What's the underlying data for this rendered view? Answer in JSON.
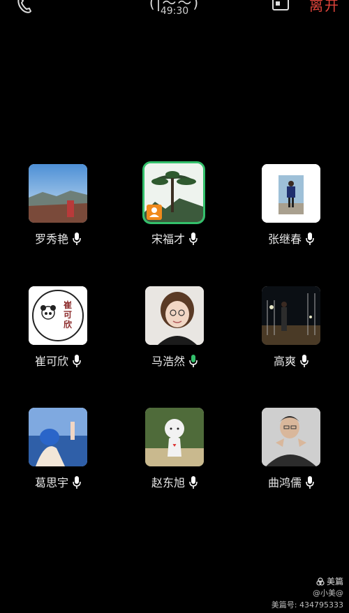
{
  "header": {
    "title_partial": "(|〜〜)",
    "timer": "49:30",
    "leave_label": "离开"
  },
  "colors": {
    "speaking_border": "#33c06b",
    "leave": "#e0443b",
    "host_badge": "#f08a1c",
    "mic_active": "#33c06b",
    "mic_idle": "#ffffff"
  },
  "participants": [
    {
      "name": "罗秀艳",
      "mic": "mic-icon",
      "speaking": false
    },
    {
      "name": "宋福才",
      "mic": "mic-icon",
      "speaking": true,
      "host": true
    },
    {
      "name": "张继春",
      "mic": "mic-icon",
      "speaking": false
    },
    {
      "name": "崔可欣",
      "mic": "mic-icon",
      "speaking": false
    },
    {
      "name": "马浩然",
      "mic": "mic-active-icon",
      "speaking": false
    },
    {
      "name": "高爽",
      "mic": "mic-icon",
      "speaking": false
    },
    {
      "name": "葛思宇",
      "mic": "mic-icon",
      "speaking": false
    },
    {
      "name": "赵东旭",
      "mic": "mic-icon",
      "speaking": false
    },
    {
      "name": "曲鸿儒",
      "mic": "mic-icon",
      "speaking": false
    }
  ],
  "avatar_texts": {
    "cui_seal_text": "崔可欣"
  },
  "watermark": {
    "brand": "美篇",
    "user": "@小美@",
    "id": "美篇号: 434795333"
  }
}
